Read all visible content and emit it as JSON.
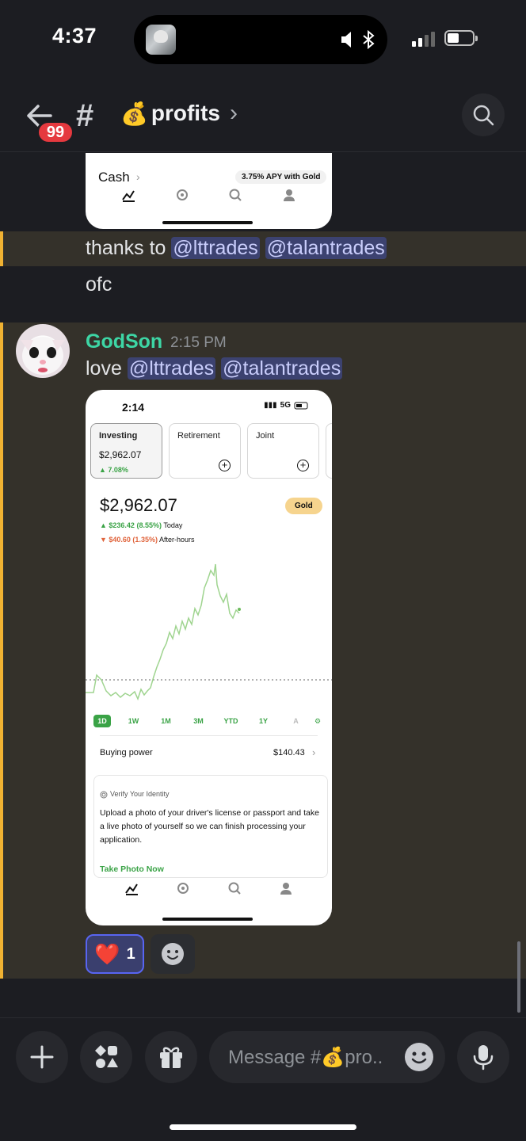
{
  "status_bar": {
    "time": "4:37"
  },
  "header": {
    "unread_badge": "99",
    "channel_prefix": "#",
    "channel_emoji": "💰",
    "channel_name": "profits",
    "chevron": "›"
  },
  "messages": [
    {
      "embed_top": {
        "cash_label": "Cash",
        "apy_pill": "3.75% APY with Gold"
      },
      "line1_prefix": "thanks to ",
      "line1_mentions": [
        "@lttrades",
        "@talantrades"
      ],
      "line2": "ofc"
    },
    {
      "author": "GodSon",
      "timestamp": "2:15 PM",
      "text_prefix": "love ",
      "mentions": [
        "@lttrades",
        "@talantrades"
      ],
      "screenshot": {
        "time": "2:14",
        "network": "5G",
        "accounts": [
          {
            "name": "Investing",
            "value": "$2,962.07",
            "change": "▲ 7.08%"
          },
          {
            "name": "Retirement"
          },
          {
            "name": "Joint"
          }
        ],
        "balance": "$2,962.07",
        "gold_badge": "Gold",
        "today_change": "▲ $236.42 (8.55%)",
        "today_label": "Today",
        "afterhours_change": "▼ $40.60 (1.35%)",
        "afterhours_label": "After-hours",
        "ranges": [
          "1D",
          "1W",
          "1M",
          "3M",
          "YTD",
          "1Y",
          "A"
        ],
        "active_range": "1D",
        "buying_power_label": "Buying power",
        "buying_power_value": "$140.43",
        "verify_title": "Verify Your Identity",
        "verify_body": "Upload a photo of your driver's license or passport and take a live photo of yourself so we can finish processing your application.",
        "verify_cta": "Take Photo Now"
      },
      "reaction": {
        "emoji": "❤️",
        "count": "1"
      }
    }
  ],
  "composer": {
    "placeholder": "Message #💰pro.."
  },
  "colors": {
    "background": "#1c1d22",
    "highlight": "#34312a",
    "highlight_bar": "#f0b232",
    "mention_bg": "#3c4270",
    "author": "#3dd6a5",
    "badge": "#e5393f",
    "robinhood_green": "#3aa346"
  }
}
